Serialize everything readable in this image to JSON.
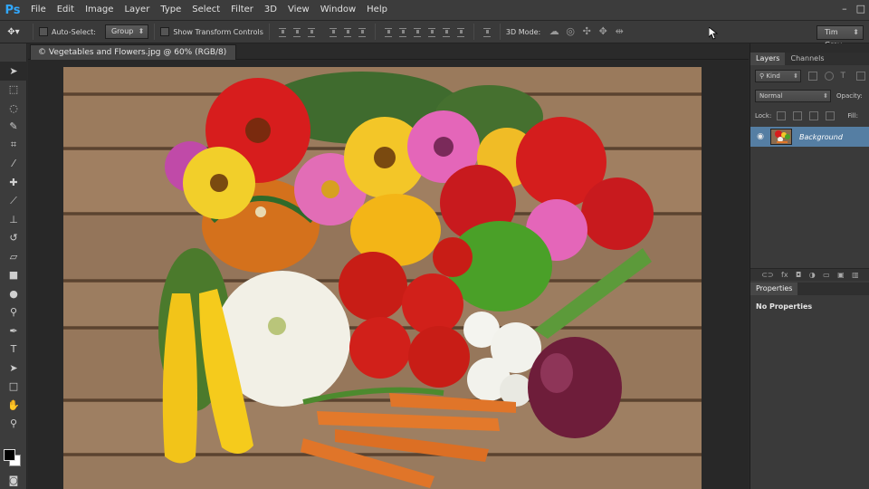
{
  "app": {
    "logo": "Ps"
  },
  "menu": [
    "File",
    "Edit",
    "Image",
    "Layer",
    "Type",
    "Select",
    "Filter",
    "3D",
    "View",
    "Window",
    "Help"
  ],
  "window_controls": [
    "–",
    "□"
  ],
  "options": {
    "auto_select_label": "Auto-Select:",
    "auto_select_value": "Group",
    "transform_label": "Show Transform Controls",
    "mode_3d_label": "3D Mode:",
    "workspace": "Tim Grey"
  },
  "document": {
    "tab_title": "© Vegetables and Flowers.jpg @ 60% (RGB/8)"
  },
  "layers_panel": {
    "tabs": [
      "Layers",
      "Channels"
    ],
    "filter_kind": "Kind",
    "blend_mode": "Normal",
    "opacity_label": "Opacity:",
    "lock_label": "Lock:",
    "fill_label": "Fill:",
    "layers": [
      {
        "name": "Background",
        "visible_icon": "eye-icon"
      }
    ]
  },
  "properties_panel": {
    "tab": "Properties",
    "empty_text": "No Properties"
  },
  "colors": {
    "foreground": "#000000",
    "background": "#ffffff",
    "accent": "#31a8ff",
    "selection": "#557ea3"
  }
}
